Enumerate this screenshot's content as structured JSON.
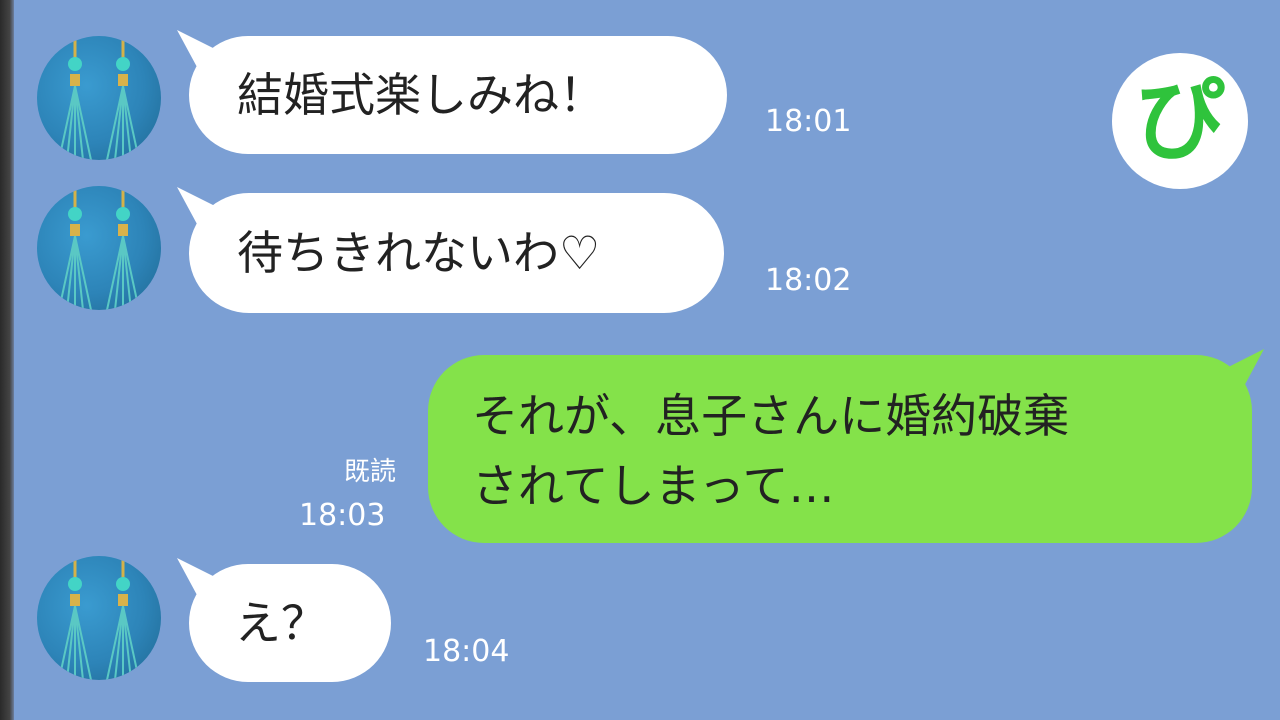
{
  "app": {
    "logo_text": "ぴ",
    "logo_color": "#2fc33c",
    "background": "#7b9fd4"
  },
  "messages": [
    {
      "from": "other",
      "text": "結婚式楽しみね！",
      "time": "18:01"
    },
    {
      "from": "other",
      "text": "待ちきれないわ♡",
      "time": "18:02"
    },
    {
      "from": "me",
      "lines": [
        "それが、息子さんに婚約破棄",
        "されてしまって…"
      ],
      "read": "既読",
      "time": "18:03"
    },
    {
      "from": "other",
      "text": "え？",
      "time": "18:04"
    }
  ],
  "colors": {
    "incoming_bubble": "#ffffff",
    "outgoing_bubble": "#84e24a",
    "timestamp": "#ffffff"
  }
}
